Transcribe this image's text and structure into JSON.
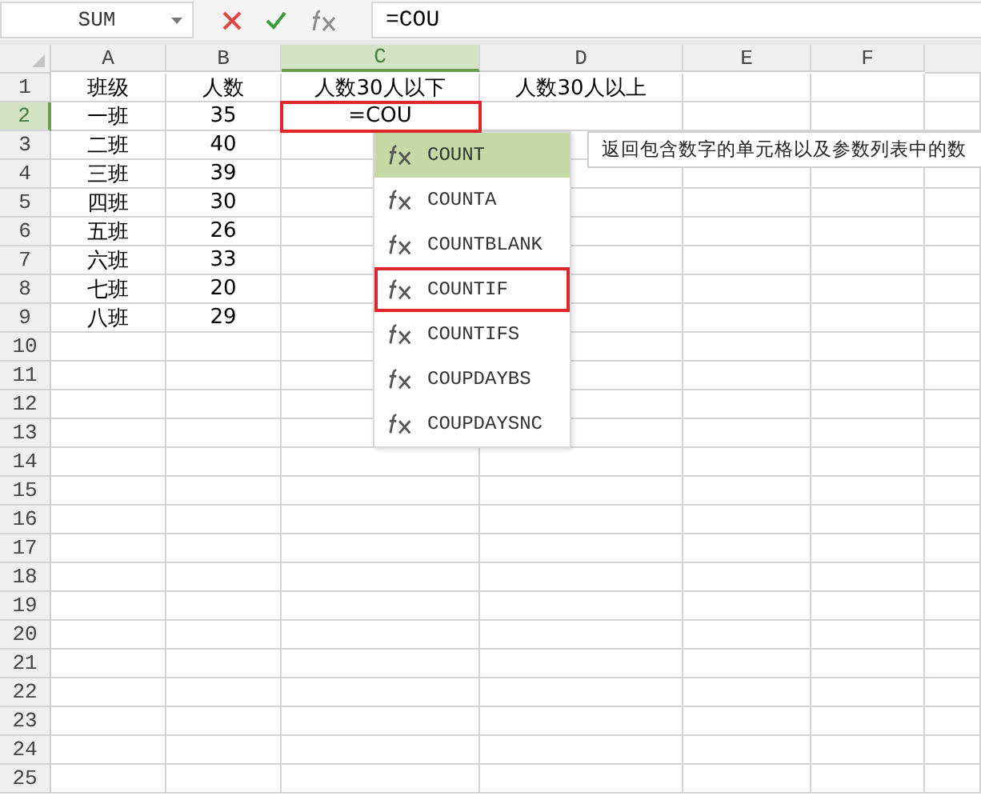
{
  "formula_bar": {
    "name_box": "SUM",
    "formula": "=COU"
  },
  "columns": [
    {
      "label": "A",
      "selected": false
    },
    {
      "label": "B",
      "selected": false
    },
    {
      "label": "C",
      "selected": true
    },
    {
      "label": "D",
      "selected": false
    },
    {
      "label": "E",
      "selected": false
    },
    {
      "label": "F",
      "selected": false
    }
  ],
  "rows": [
    {
      "number": "1",
      "selected": false,
      "cells": [
        "班级",
        "人数",
        "人数30人以下",
        "人数30人以上"
      ]
    },
    {
      "number": "2",
      "selected": true,
      "cells": [
        "一班",
        "35",
        "=COU"
      ]
    },
    {
      "number": "3",
      "selected": false,
      "cells": [
        "二班",
        "40"
      ]
    },
    {
      "number": "4",
      "selected": false,
      "cells": [
        "三班",
        "39"
      ]
    },
    {
      "number": "5",
      "selected": false,
      "cells": [
        "四班",
        "30"
      ]
    },
    {
      "number": "6",
      "selected": false,
      "cells": [
        "五班",
        "26"
      ]
    },
    {
      "number": "7",
      "selected": false,
      "cells": [
        "六班",
        "33"
      ]
    },
    {
      "number": "8",
      "selected": false,
      "cells": [
        "七班",
        "20"
      ]
    },
    {
      "number": "9",
      "selected": false,
      "cells": [
        "八班",
        "29"
      ]
    },
    {
      "number": "10",
      "selected": false,
      "cells": []
    },
    {
      "number": "11",
      "selected": false,
      "cells": []
    },
    {
      "number": "12",
      "selected": false,
      "cells": []
    },
    {
      "number": "13",
      "selected": false,
      "cells": []
    },
    {
      "number": "14",
      "selected": false,
      "cells": []
    },
    {
      "number": "15",
      "selected": false,
      "cells": []
    },
    {
      "number": "16",
      "selected": false,
      "cells": []
    },
    {
      "number": "17",
      "selected": false,
      "cells": []
    },
    {
      "number": "18",
      "selected": false,
      "cells": []
    },
    {
      "number": "19",
      "selected": false,
      "cells": []
    },
    {
      "number": "20",
      "selected": false,
      "cells": []
    },
    {
      "number": "21",
      "selected": false,
      "cells": []
    },
    {
      "number": "22",
      "selected": false,
      "cells": []
    },
    {
      "number": "23",
      "selected": false,
      "cells": []
    },
    {
      "number": "24",
      "selected": false,
      "cells": []
    },
    {
      "number": "25",
      "selected": false,
      "cells": []
    }
  ],
  "autocomplete": {
    "items": [
      {
        "label": "COUNT",
        "selected": true,
        "highlighted": false
      },
      {
        "label": "COUNTA",
        "selected": false,
        "highlighted": false
      },
      {
        "label": "COUNTBLANK",
        "selected": false,
        "highlighted": false
      },
      {
        "label": "COUNTIF",
        "selected": false,
        "highlighted": true
      },
      {
        "label": "COUNTIFS",
        "selected": false,
        "highlighted": false
      },
      {
        "label": "COUPDAYBS",
        "selected": false,
        "highlighted": false
      },
      {
        "label": "COUPDAYSNC",
        "selected": false,
        "highlighted": false
      }
    ],
    "tooltip": "返回包含数字的单元格以及参数列表中的数"
  }
}
